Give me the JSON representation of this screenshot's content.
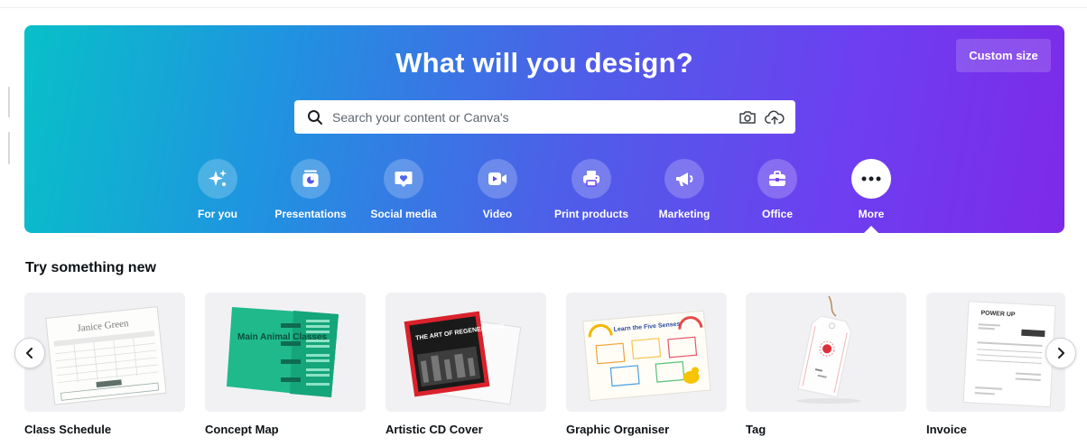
{
  "hero": {
    "title": "What will you design?",
    "custom_size_label": "Custom size",
    "search_placeholder": "Search your content or Canva's",
    "gradient_start": "#08c0c8",
    "gradient_end": "#7d2ae8"
  },
  "categories": [
    {
      "label": "For you",
      "icon": "sparkle-icon"
    },
    {
      "label": "Presentations",
      "icon": "presentation-icon"
    },
    {
      "label": "Social media",
      "icon": "heart-message-icon"
    },
    {
      "label": "Video",
      "icon": "video-camera-icon"
    },
    {
      "label": "Print products",
      "icon": "printer-icon"
    },
    {
      "label": "Marketing",
      "icon": "megaphone-icon"
    },
    {
      "label": "Office",
      "icon": "briefcase-icon"
    },
    {
      "label": "More",
      "icon": "more-dots-icon",
      "active": true
    }
  ],
  "section": {
    "title": "Try something new"
  },
  "cards": [
    {
      "title": "Class Schedule",
      "thumb_text": [
        "Janice Green"
      ]
    },
    {
      "title": "Concept Map",
      "thumb_text": [
        "Main Animal Classes"
      ]
    },
    {
      "title": "Artistic CD Cover",
      "thumb_text": [
        "THE ART OF REGENERATION"
      ]
    },
    {
      "title": "Graphic Organiser",
      "thumb_text": [
        "Learn the Five Senses"
      ]
    },
    {
      "title": "Tag",
      "thumb_text": []
    },
    {
      "title": "Invoice",
      "thumb_text": [
        "POWER UP"
      ]
    }
  ]
}
